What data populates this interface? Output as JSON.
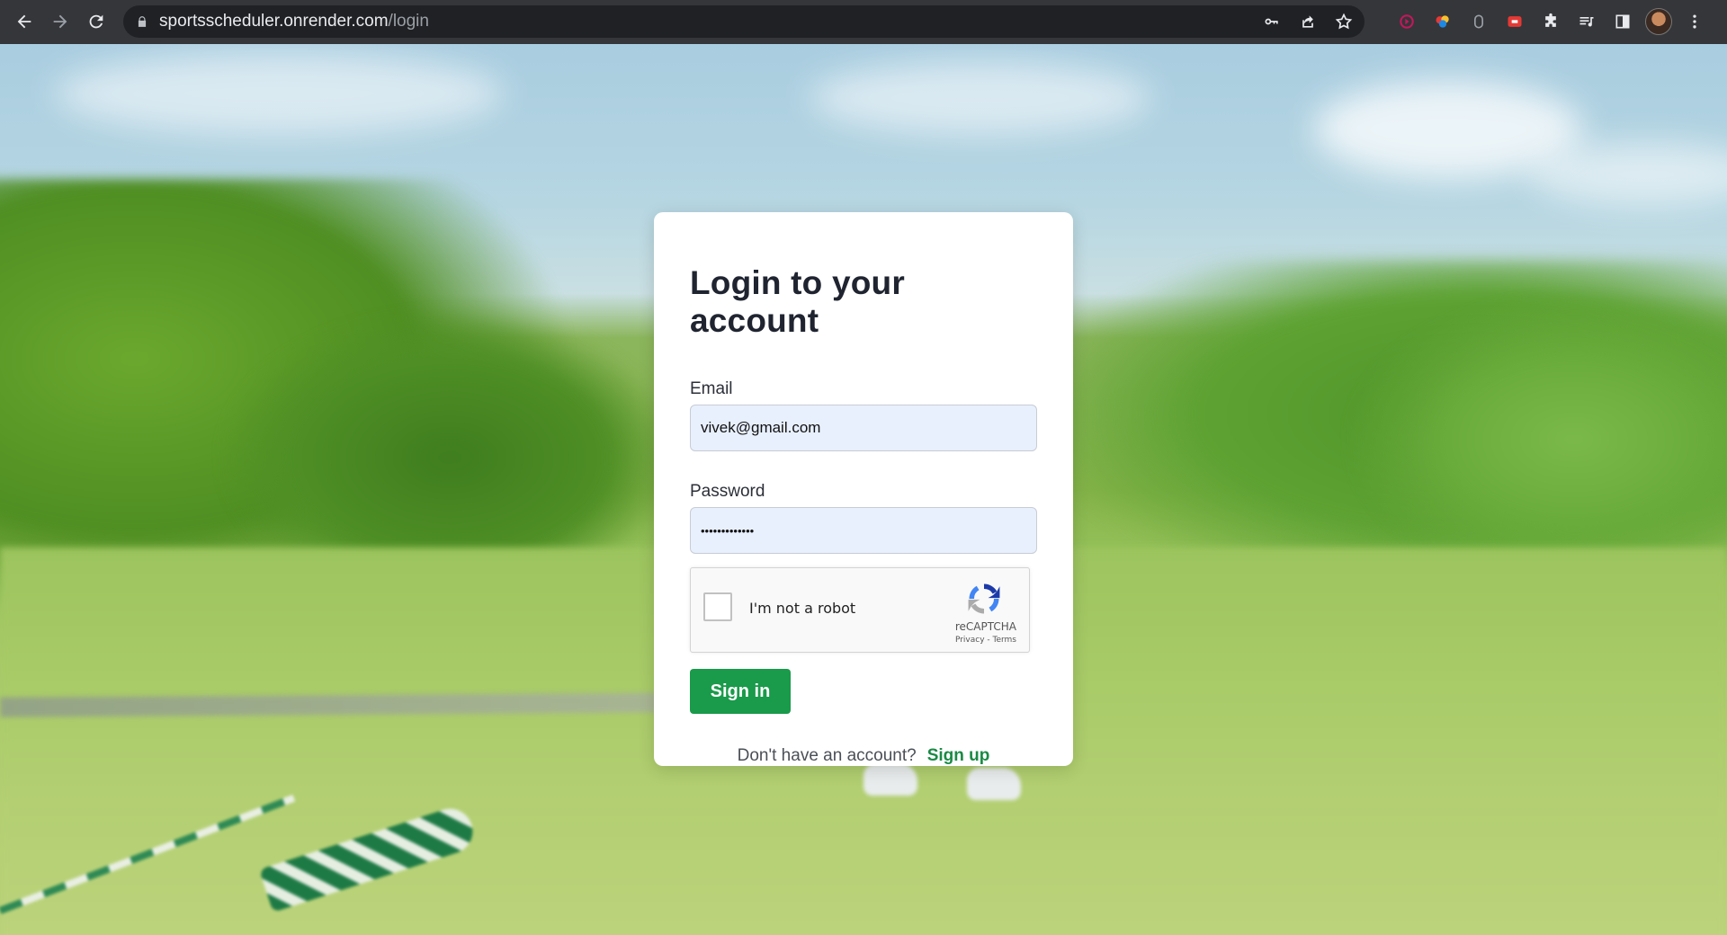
{
  "browser": {
    "url_host": "sportsscheduler.onrender.com",
    "url_path": "/login",
    "icons": [
      "back-icon",
      "forward-icon",
      "reload-icon",
      "lock-icon",
      "key-icon",
      "share-icon",
      "star-icon",
      "extension-icons",
      "puzzle-icon",
      "media-icon",
      "sidebar-icon",
      "avatar",
      "menu-icon"
    ]
  },
  "login": {
    "title": "Login to your account",
    "email_label": "Email",
    "email_value": "vivek@gmail.com",
    "password_label": "Password",
    "password_value": "•••••••••••••",
    "recaptcha_label": "I'm not a robot",
    "recaptcha_brand": "reCAPTCHA",
    "recaptcha_links": "Privacy - Terms",
    "signin_label": "Sign in",
    "signup_prompt": "Don't have an account?",
    "signup_link": "Sign up"
  },
  "colors": {
    "primary_button": "#1a9a4b",
    "link": "#198a44",
    "input_fill": "#e8f0fe"
  }
}
